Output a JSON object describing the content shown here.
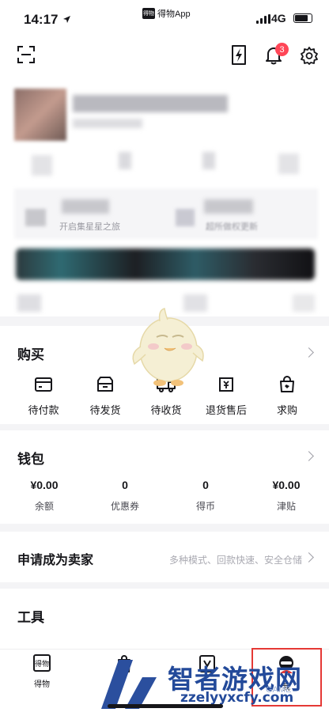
{
  "status_bar": {
    "time": "14:17",
    "app_name": "得物App",
    "app_mark": "得物",
    "network": "4G"
  },
  "header": {
    "scan_icon": "scan-icon",
    "flash_icon": "lightning-card-icon",
    "bell_icon": "bell-icon",
    "notification_count": "3",
    "settings_icon": "gear-icon"
  },
  "profile": {
    "promo_left": "开启集星星之旅",
    "promo_right": "超所做权更新"
  },
  "orders": {
    "title": "购买",
    "items": [
      {
        "label": "待付款",
        "icon": "card-icon"
      },
      {
        "label": "待发货",
        "icon": "box-icon"
      },
      {
        "label": "待收货",
        "icon": "truck-icon"
      },
      {
        "label": "退货售后",
        "icon": "refund-icon"
      },
      {
        "label": "求购",
        "icon": "bag-icon"
      }
    ]
  },
  "wallet": {
    "title": "钱包",
    "items": [
      {
        "value": "¥0.00",
        "label": "余额"
      },
      {
        "value": "0",
        "label": "优惠券"
      },
      {
        "value": "0",
        "label": "得币"
      },
      {
        "value": "¥0.00",
        "label": "津贴"
      }
    ]
  },
  "seller": {
    "title": "申请成为卖家",
    "subtitle": "多种模式、回款快速、安全仓储"
  },
  "tools": {
    "title": "工具"
  },
  "tabbar": {
    "tabs": [
      {
        "label": "得物",
        "icon": "dewu-home-icon"
      },
      {
        "label": "",
        "icon": "shopping-bag-icon"
      },
      {
        "label": "",
        "icon": "v-badge-icon"
      },
      {
        "label": "我",
        "icon": "profile-avatar-icon"
      }
    ],
    "highlight_color": "#e53935"
  },
  "watermark": {
    "title": "智者游戏网",
    "url": "zzelyyxcfy.com",
    "game": "GAME"
  }
}
